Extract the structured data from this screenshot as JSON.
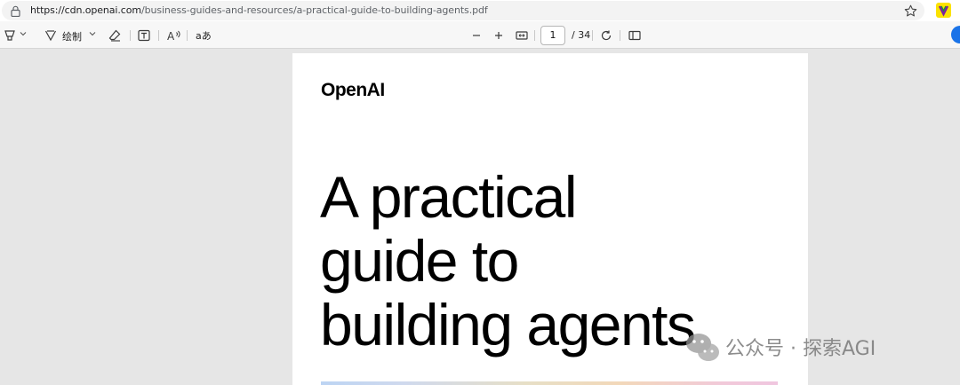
{
  "browser": {
    "url_host": "https://cdn.openai.com",
    "url_path": "/business-guides-and-resources/a-practical-guide-to-building-agents.pdf",
    "icons": [
      "lock-icon",
      "star-icon",
      "extension-icon"
    ]
  },
  "toolbar": {
    "draw_label": "绘制",
    "read_aloud_label": "A",
    "translate_label": "aあ",
    "page_current": "1",
    "page_total": "/ 34",
    "icons": [
      "highlight-icon",
      "draw-icon",
      "eraser-icon",
      "text-box-icon",
      "read-aloud-icon",
      "zoom-out-icon",
      "zoom-in-icon",
      "fit-page-icon",
      "rotate-icon",
      "page-view-icon"
    ]
  },
  "document": {
    "brand": "OpenAI",
    "title_lines": [
      "A practical",
      "guide to",
      "building agents"
    ]
  },
  "watermark": {
    "text": "公众号 · 探索AGI"
  },
  "colors": {
    "accent": "#1a73e8",
    "extension": "#fbe200",
    "viewer_bg": "#e6e6e6"
  }
}
